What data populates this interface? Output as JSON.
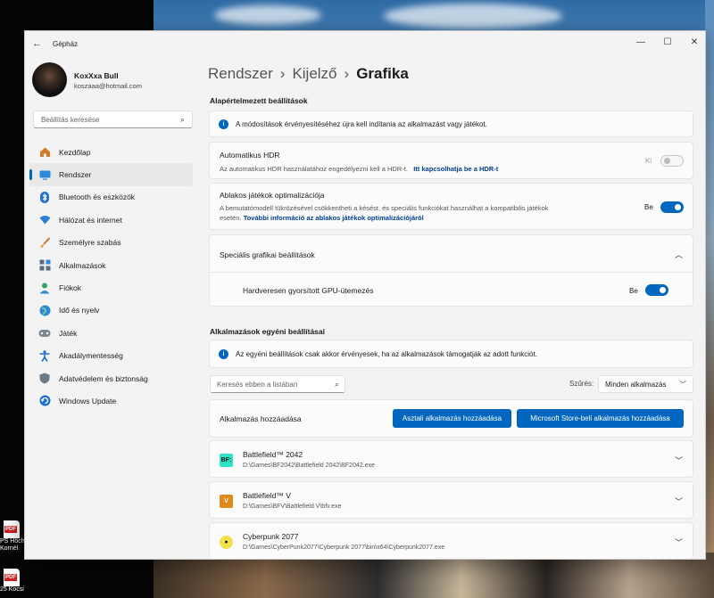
{
  "desktop": {
    "icons": [
      {
        "label_1": "PS Höch",
        "label_2": "Kornél",
        "badge": "PDF"
      },
      {
        "label_1": "25 Kocsi",
        "label_2": "",
        "badge": "PDF"
      }
    ]
  },
  "window": {
    "app_title": "Gépház",
    "controls": {
      "minimize": "—",
      "maximize": "☐",
      "close": "✕"
    }
  },
  "user": {
    "name": "KoxXxa Bull",
    "email": "koszaaa@hotmail.com"
  },
  "sidebar": {
    "search_placeholder": "Beállítás keresése",
    "items": [
      {
        "label": "Kezdőlap",
        "icon": "home-icon",
        "active": false
      },
      {
        "label": "Rendszer",
        "icon": "system-icon",
        "active": true
      },
      {
        "label": "Bluetooth és eszközök",
        "icon": "bluetooth-icon",
        "active": false
      },
      {
        "label": "Hálózat és internet",
        "icon": "network-icon",
        "active": false
      },
      {
        "label": "Személyre szabás",
        "icon": "brush-icon",
        "active": false
      },
      {
        "label": "Alkalmazások",
        "icon": "apps-icon",
        "active": false
      },
      {
        "label": "Fiókok",
        "icon": "account-icon",
        "active": false
      },
      {
        "label": "Idő és nyelv",
        "icon": "globe-icon",
        "active": false
      },
      {
        "label": "Játék",
        "icon": "gamepad-icon",
        "active": false
      },
      {
        "label": "Akadálymentesség",
        "icon": "accessibility-icon",
        "active": false
      },
      {
        "label": "Adatvédelem és biztonság",
        "icon": "shield-icon",
        "active": false
      },
      {
        "label": "Windows Update",
        "icon": "update-icon",
        "active": false
      }
    ]
  },
  "breadcrumb": {
    "part1": "Rendszer",
    "part2": "Kijelző",
    "current": "Grafika",
    "separator": "›"
  },
  "defaults": {
    "heading": "Alapértelmezett beállítások",
    "restart_notice": "A módosítások érvényesítéséhez újra kell indítania az alkalmazást vagy játékot.",
    "auto_hdr": {
      "title": "Automatikus HDR",
      "desc": "Az automatikus HDR használatához engedélyezni kell a HDR-t.",
      "link": "Itt kapcsolhatja be a HDR-t",
      "state_label": "Ki",
      "on": false
    },
    "windowed_opt": {
      "title": "Ablakos játékok optimalizációja",
      "desc_1": "A bemutatómodell tükrözésével csökkentheti a késést, és speciális funkciókat használhat a kompatibilis játékok",
      "desc_2_prefix": "esetén.",
      "link": "További információ az ablakos játékok optimalizációjáról",
      "state_label": "Be",
      "on": true
    },
    "advanced": {
      "title": "Speciális grafikai beállítások",
      "gpu_scheduling": {
        "title": "Hardveresen gyorsított GPU-ütemezés",
        "state_label": "Be",
        "on": true
      }
    }
  },
  "per_app": {
    "heading": "Alkalmazások egyéni beállításai",
    "notice": "Az egyéni beállítások csak akkor érvényesek, ha az alkalmazások támogatják az adott funkciót.",
    "search_placeholder": "Keresés ebben a listában",
    "filter_label": "Szűrés:",
    "filter_value": "Minden alkalmazás",
    "add_label": "Alkalmazás hozzáadása",
    "add_desktop_btn": "Asztali alkalmazás hozzáadása",
    "add_store_btn": "Microsoft Store-beli alkalmazás hozzáadása",
    "apps": [
      {
        "name": "Battlefield™ 2042",
        "path": "D:\\Games\\BF2042\\Battlefield 2042\\BF2042.exe",
        "icon_text": "BF:",
        "icon_bg": "#2de3c8",
        "icon_fg": "#111111"
      },
      {
        "name": "Battlefield™ V",
        "path": "D:\\Games\\BFV\\Battlefield V\\bfv.exe",
        "icon_text": "V",
        "icon_bg": "#e08a1e",
        "icon_fg": "#ffffff"
      },
      {
        "name": "Cyberpunk 2077",
        "path": "D:\\Games\\CyberPunk2077\\Cyberpunk 2077\\bin\\x64\\Cyberpunk2077.exe",
        "icon_text": "●",
        "icon_bg": "#f2e04a",
        "icon_fg": "#1a1a1a"
      }
    ]
  },
  "colors": {
    "accent": "#0067c0",
    "link": "#003e92"
  }
}
